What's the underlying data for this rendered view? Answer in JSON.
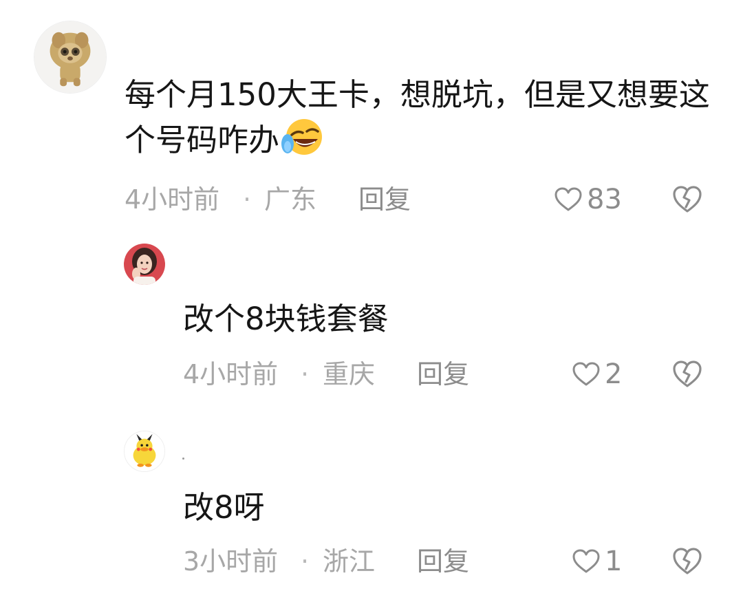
{
  "comments": [
    {
      "text": "每个月150大王卡，想脱坑，但是又想要这个号码咋办",
      "emoji": "rofl-face-emoji",
      "time": "4小时前",
      "separator": "·",
      "location": "广东",
      "reply_label": "回复",
      "likes": "83",
      "avatar": "lion-toy-avatar"
    },
    {
      "text": "改个8块钱套餐",
      "time": "4小时前",
      "separator": "·",
      "location": "重庆",
      "reply_label": "回复",
      "likes": "2",
      "avatar": "woman-portrait-avatar"
    },
    {
      "text": "改8呀",
      "time": "3小时前",
      "separator": "·",
      "location": "浙江",
      "reply_label": "回复",
      "likes": "1",
      "avatar": "yellow-duck-avatar"
    }
  ],
  "colors": {
    "text": "#161616",
    "meta": "#a7a7a7",
    "icon": "#8c8c8c",
    "background": "#ffffff"
  }
}
